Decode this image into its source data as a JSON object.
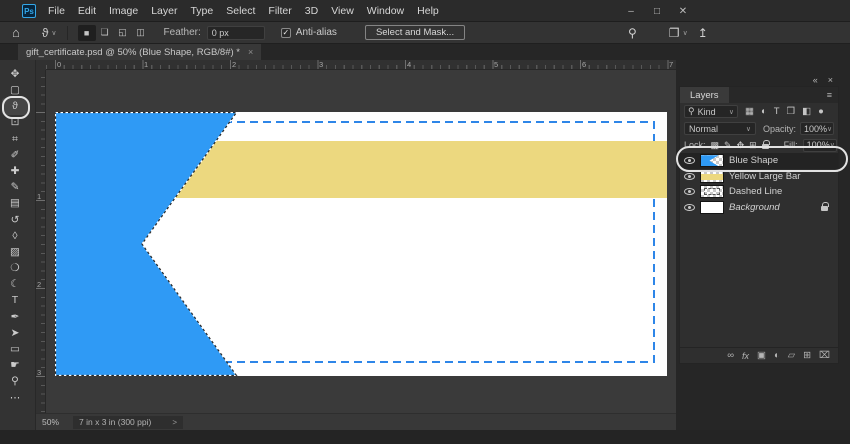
{
  "window": {
    "logo": "Ps",
    "controls": {
      "minimize": "–",
      "maximize": "□",
      "close": "✕"
    }
  },
  "menu_bar": {
    "items": [
      "File",
      "Edit",
      "Image",
      "Layer",
      "Type",
      "Select",
      "Filter",
      "3D",
      "View",
      "Window",
      "Help"
    ]
  },
  "options_bar": {
    "home_icon": "⌂",
    "tool_icon": "ϑ",
    "dropdown_chevron": "∨",
    "selection_modes": [
      {
        "name": "new-selection",
        "glyph": "■"
      },
      {
        "name": "add-to-selection",
        "glyph": "❏"
      },
      {
        "name": "subtract-from-selection",
        "glyph": "◱"
      },
      {
        "name": "intersect-with-selection",
        "glyph": "◫"
      }
    ],
    "feather_label": "Feather:",
    "feather_value": "0 px",
    "anti_alias_checked": "✓",
    "anti_alias_label": "Anti-alias",
    "select_and_mask_label": "Select and Mask...",
    "search_icon": "⚲",
    "workspace_icon": "❐",
    "share_icon": "↥"
  },
  "document_tab": {
    "title": "gift_certificate.psd @ 50% (Blue Shape, RGB/8#) *",
    "close_icon": "×"
  },
  "toolbar": {
    "tools": [
      {
        "name": "move",
        "glyph": "✥"
      },
      {
        "name": "rectangular-marquee",
        "glyph": "▢"
      },
      {
        "name": "lasso",
        "glyph": "ϑ"
      },
      {
        "name": "object-selection",
        "glyph": "⊡"
      },
      {
        "name": "crop",
        "glyph": "⌗"
      },
      {
        "name": "eyedropper",
        "glyph": "✐"
      },
      {
        "name": "healing-brush",
        "glyph": "✚"
      },
      {
        "name": "brush",
        "glyph": "✎"
      },
      {
        "name": "clone-stamp",
        "glyph": "▤"
      },
      {
        "name": "history-brush",
        "glyph": "↺"
      },
      {
        "name": "eraser",
        "glyph": "◊"
      },
      {
        "name": "gradient",
        "glyph": "▨"
      },
      {
        "name": "blur",
        "glyph": "❍"
      },
      {
        "name": "dodge",
        "glyph": "☾"
      },
      {
        "name": "type",
        "glyph": "T"
      },
      {
        "name": "pen",
        "glyph": "✒"
      },
      {
        "name": "path-selection",
        "glyph": "➤"
      },
      {
        "name": "rectangle",
        "glyph": "▭"
      },
      {
        "name": "hand",
        "glyph": "☛"
      },
      {
        "name": "zoom",
        "glyph": "⚲"
      },
      {
        "name": "edit-toolbar",
        "glyph": "⋯"
      }
    ]
  },
  "rulers": {
    "horizontal": [
      "0",
      "1",
      "2",
      "3",
      "4",
      "5",
      "6",
      "7"
    ],
    "vertical": [
      "1",
      "2",
      "3"
    ]
  },
  "canvas": {
    "colors": {
      "white": "#ffffff",
      "blue": "#2f9af5",
      "yellow": "#ecd87f",
      "dash_blue": "#2e86e8",
      "ants_dark": "#2b2b2b",
      "ants_light": "#ffffff"
    }
  },
  "layers_panel": {
    "collapse_icon": "«",
    "close_icon": "×",
    "panel_tab": "Layers",
    "menu_icon": "≡",
    "filter": {
      "search_icon": "⚲",
      "kind_label": "Kind",
      "chevron": "∨",
      "type_icons": [
        {
          "name": "pixel-layer-filter",
          "glyph": "▦"
        },
        {
          "name": "adjustment-layer-filter",
          "glyph": "◐"
        },
        {
          "name": "type-layer-filter",
          "glyph": "T"
        },
        {
          "name": "shape-layer-filter",
          "glyph": "❒"
        },
        {
          "name": "smart-object-filter",
          "glyph": "◧"
        },
        {
          "name": "filter-toggle",
          "glyph": "●"
        }
      ]
    },
    "blend_mode": {
      "value": "Normal",
      "chevron": "∨"
    },
    "opacity": {
      "label": "Opacity:",
      "value": "100%",
      "chevron": "∨"
    },
    "lock": {
      "label": "Lock:",
      "icons": [
        {
          "name": "lock-transparent-pixels",
          "glyph": "▩"
        },
        {
          "name": "lock-image-pixels",
          "glyph": "✎"
        },
        {
          "name": "lock-position",
          "glyph": "✥"
        },
        {
          "name": "lock-artboard",
          "glyph": "⊞"
        }
      ]
    },
    "fill": {
      "label": "Fill:",
      "value": "100%",
      "chevron": "∨"
    },
    "layers": [
      {
        "name": "Blue Shape"
      },
      {
        "name": "Yellow Large Bar"
      },
      {
        "name": "Dashed Line"
      },
      {
        "name": "Background"
      }
    ],
    "bottom_icons": [
      {
        "name": "link-layers",
        "glyph": "∞"
      },
      {
        "name": "layer-effects",
        "glyph": "fx"
      },
      {
        "name": "add-layer-mask",
        "glyph": "▣"
      },
      {
        "name": "new-adjustment-layer",
        "glyph": "◐"
      },
      {
        "name": "new-group",
        "glyph": "▱"
      },
      {
        "name": "new-layer",
        "glyph": "⊞"
      },
      {
        "name": "delete-layer",
        "glyph": "⌧"
      }
    ]
  },
  "status_bar": {
    "zoom_level": "50%",
    "document_info": "7 in x 3 in (300 ppi)",
    "chevron": ">"
  }
}
